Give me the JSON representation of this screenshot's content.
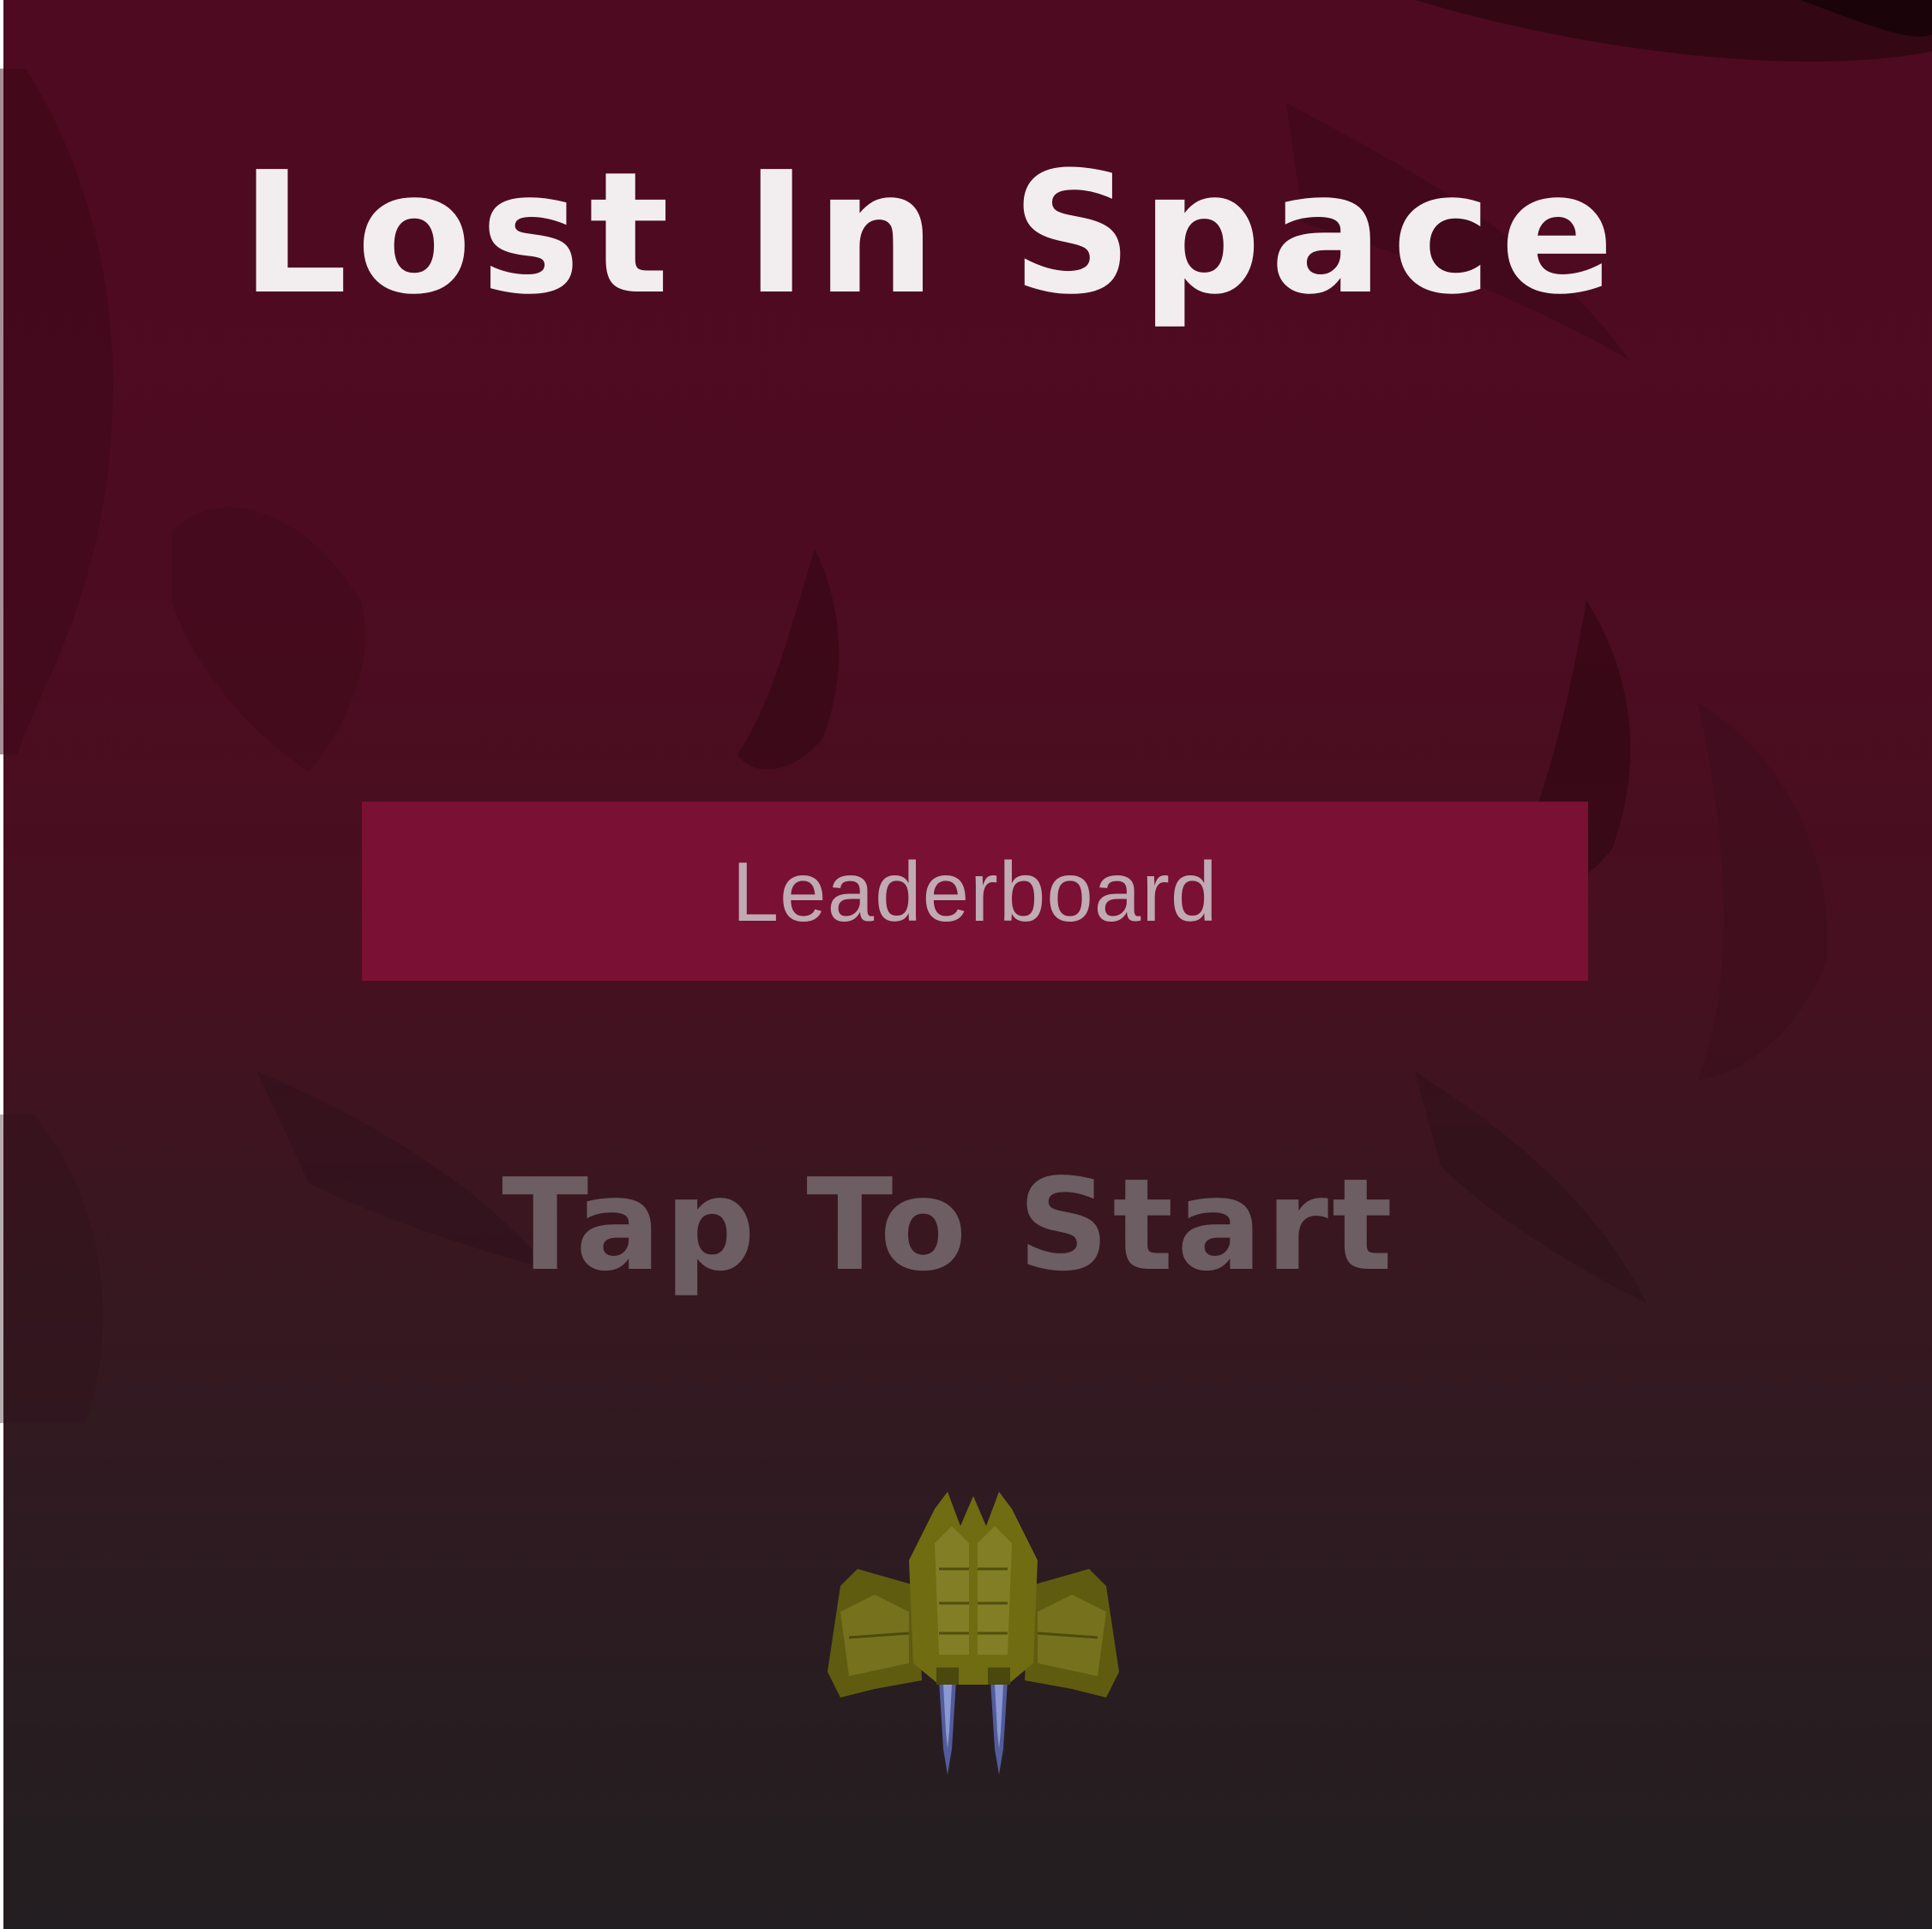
{
  "game": {
    "title": "Lost In Space",
    "leaderboard_label": "Leaderboard",
    "tap_to_start_label": "Tap To Start"
  },
  "colors": {
    "background_top": "#4e0a20",
    "background_bottom": "#231e21",
    "title_text": "#f2eef0",
    "button_fill": "#7a1033",
    "button_text": "#c0aab3",
    "prompt_text": "#6c5e63",
    "ship_body": "#6f6c12",
    "ship_thruster": "#5a66b0"
  },
  "icons": {
    "player_ship": "spaceship-icon"
  }
}
